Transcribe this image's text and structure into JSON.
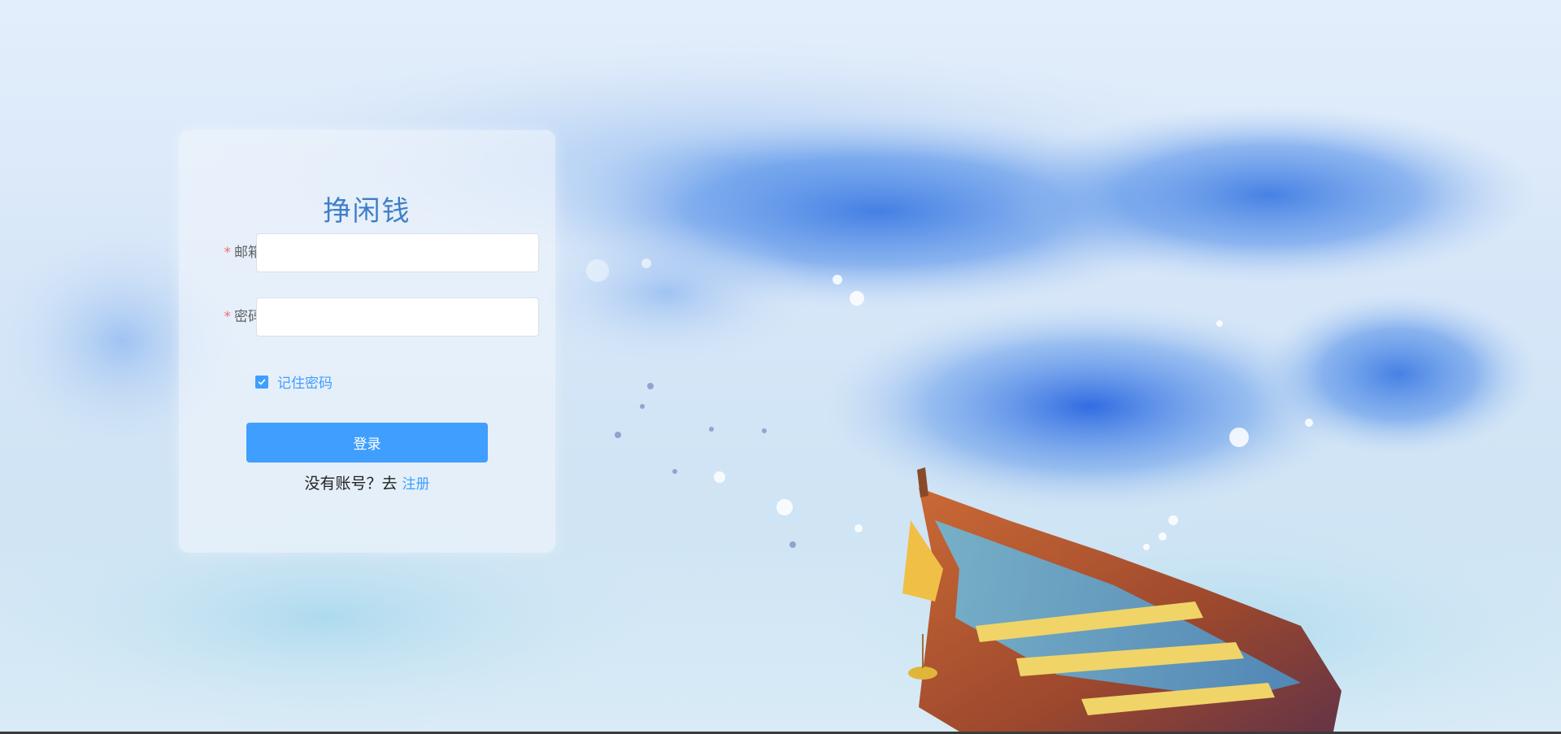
{
  "login_form": {
    "title": "挣闲钱",
    "email_label": "邮箱",
    "email_value": "",
    "password_label": "密码",
    "password_value": "",
    "required_mark": "*",
    "remember_label": "记住密码",
    "remember_checked": true,
    "login_button": "登录",
    "register_prompt": "没有账号？去",
    "register_link": "注册"
  },
  "colors": {
    "primary": "#409eff",
    "required": "#f56c6c",
    "title": "#3f7fc8"
  }
}
